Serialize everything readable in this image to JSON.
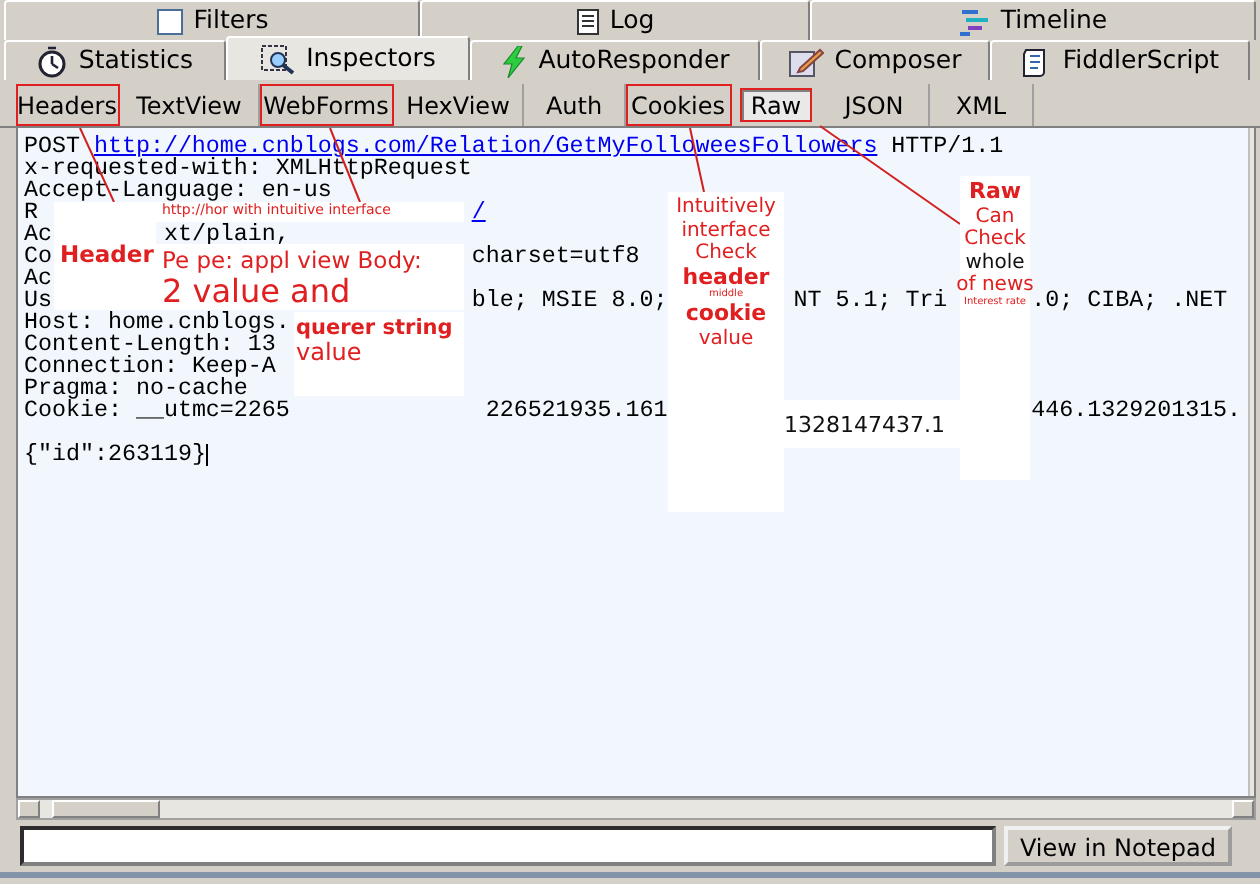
{
  "main_tabs": [
    {
      "label": "Filters",
      "selected": false
    },
    {
      "label": "Log",
      "selected": false
    },
    {
      "label": "Timeline",
      "selected": false
    }
  ],
  "tool_tabs": [
    {
      "label": "Statistics",
      "selected": false
    },
    {
      "label": "Inspectors",
      "selected": true
    },
    {
      "label": "AutoResponder",
      "selected": false
    },
    {
      "label": "Composer",
      "selected": false
    },
    {
      "label": "FiddlerScript",
      "selected": false
    }
  ],
  "inspector_tabs": [
    {
      "label": "Headers",
      "selected": false,
      "highlighted": true
    },
    {
      "label": "TextView",
      "selected": false,
      "highlighted": false
    },
    {
      "label": "WebForms",
      "selected": false,
      "highlighted": true
    },
    {
      "label": "HexView",
      "selected": false,
      "highlighted": false
    },
    {
      "label": "Auth",
      "selected": false,
      "highlighted": false
    },
    {
      "label": "Cookies",
      "selected": false,
      "highlighted": true
    },
    {
      "label": "Raw",
      "selected": true,
      "highlighted": true
    },
    {
      "label": "JSON",
      "selected": false,
      "highlighted": false
    },
    {
      "label": "XML",
      "selected": false,
      "highlighted": false
    }
  ],
  "raw_lines": [
    {
      "parts": [
        {
          "kind": "text",
          "text": "POST"
        },
        {
          "kind": "link",
          "text": "http://home.cnblogs.com/Relation/GetMyFolloweesFollowers"
        },
        {
          "kind": "text",
          "text": "HTTP/1.1"
        }
      ]
    },
    {
      "parts": [
        {
          "kind": "text",
          "text": "x-requested-with: XMLHttpRequest"
        }
      ]
    },
    {
      "parts": [
        {
          "kind": "text",
          "text": "Accept-Language: en-us"
        }
      ]
    },
    {
      "parts": [
        {
          "kind": "text",
          "text": "R"
        },
        {
          "kind": "link",
          "text": "/"
        }
      ]
    },
    {
      "parts": [
        {
          "kind": "text",
          "text": "Ac"
        },
        {
          "kind": "text",
          "text": "xt/plain,"
        }
      ]
    },
    {
      "parts": [
        {
          "kind": "text",
          "text": "Co"
        },
        {
          "kind": "text",
          "text": "charset=utf8"
        }
      ]
    },
    {
      "parts": [
        {
          "kind": "text",
          "text": "Ac"
        }
      ]
    },
    {
      "parts": [
        {
          "kind": "text",
          "text": "Us"
        },
        {
          "kind": "text",
          "text": "ble; MSIE 8.0;"
        },
        {
          "kind": "text",
          "text": "NT 5.1; Tri"
        },
        {
          "kind": "text",
          "text": ".0; CIBA; .NET"
        }
      ]
    },
    {
      "parts": [
        {
          "kind": "text",
          "text": "Host: home.cnblogs."
        }
      ]
    },
    {
      "parts": [
        {
          "kind": "text",
          "text": "Content-Length: 13"
        }
      ]
    },
    {
      "parts": [
        {
          "kind": "text",
          "text": "Connection: Keep-A"
        }
      ]
    },
    {
      "parts": [
        {
          "kind": "text",
          "text": "Pragma: no-cache"
        }
      ]
    },
    {
      "parts": [
        {
          "kind": "text",
          "text": "Cookie: __utmc=2265"
        },
        {
          "kind": "text",
          "text": "226521935.161"
        },
        {
          "kind": "text",
          "text": "446.1329201315."
        }
      ]
    },
    {
      "parts": [
        {
          "kind": "text",
          "text": "{\"id\":263119}"
        }
      ]
    }
  ],
  "annotations": [
    {
      "lines": [
        {
          "kind": "tiny",
          "text": "http://hor with intuitive interface"
        }
      ]
    },
    {
      "lines": [
        {
          "kind": "bold",
          "text": "Header"
        }
      ]
    },
    {
      "lines": [
        {
          "kind": "plain",
          "text": "Pe pe: appl view Body:"
        },
        {
          "kind": "large",
          "text": "2 value and"
        }
      ]
    },
    {
      "lines": [
        {
          "kind": "bold",
          "text": "querer string"
        },
        {
          "kind": "plain",
          "text": "value"
        }
      ]
    },
    {
      "lines": [
        {
          "kind": "plain",
          "text": "Intuitively"
        },
        {
          "kind": "plain",
          "text": "interface"
        },
        {
          "kind": "plain",
          "text": "Check"
        },
        {
          "kind": "bold",
          "text": "header"
        },
        {
          "kind": "tiny",
          "text": "middle"
        },
        {
          "kind": "bold",
          "text": "cookie"
        },
        {
          "kind": "plain",
          "text": "value"
        }
      ]
    },
    {
      "lines": [
        {
          "kind": "black",
          "text": "1328147437.1"
        }
      ]
    },
    {
      "lines": [
        {
          "kind": "bold",
          "text": "Raw"
        },
        {
          "kind": "plain",
          "text": "Can"
        },
        {
          "kind": "plain",
          "text": "Check"
        },
        {
          "kind": "black",
          "text": "whole"
        },
        {
          "kind": "plain",
          "text": "of news"
        },
        {
          "kind": "tiny",
          "text": "Interest rate"
        }
      ]
    }
  ],
  "notepad_button": "View in Notepad"
}
